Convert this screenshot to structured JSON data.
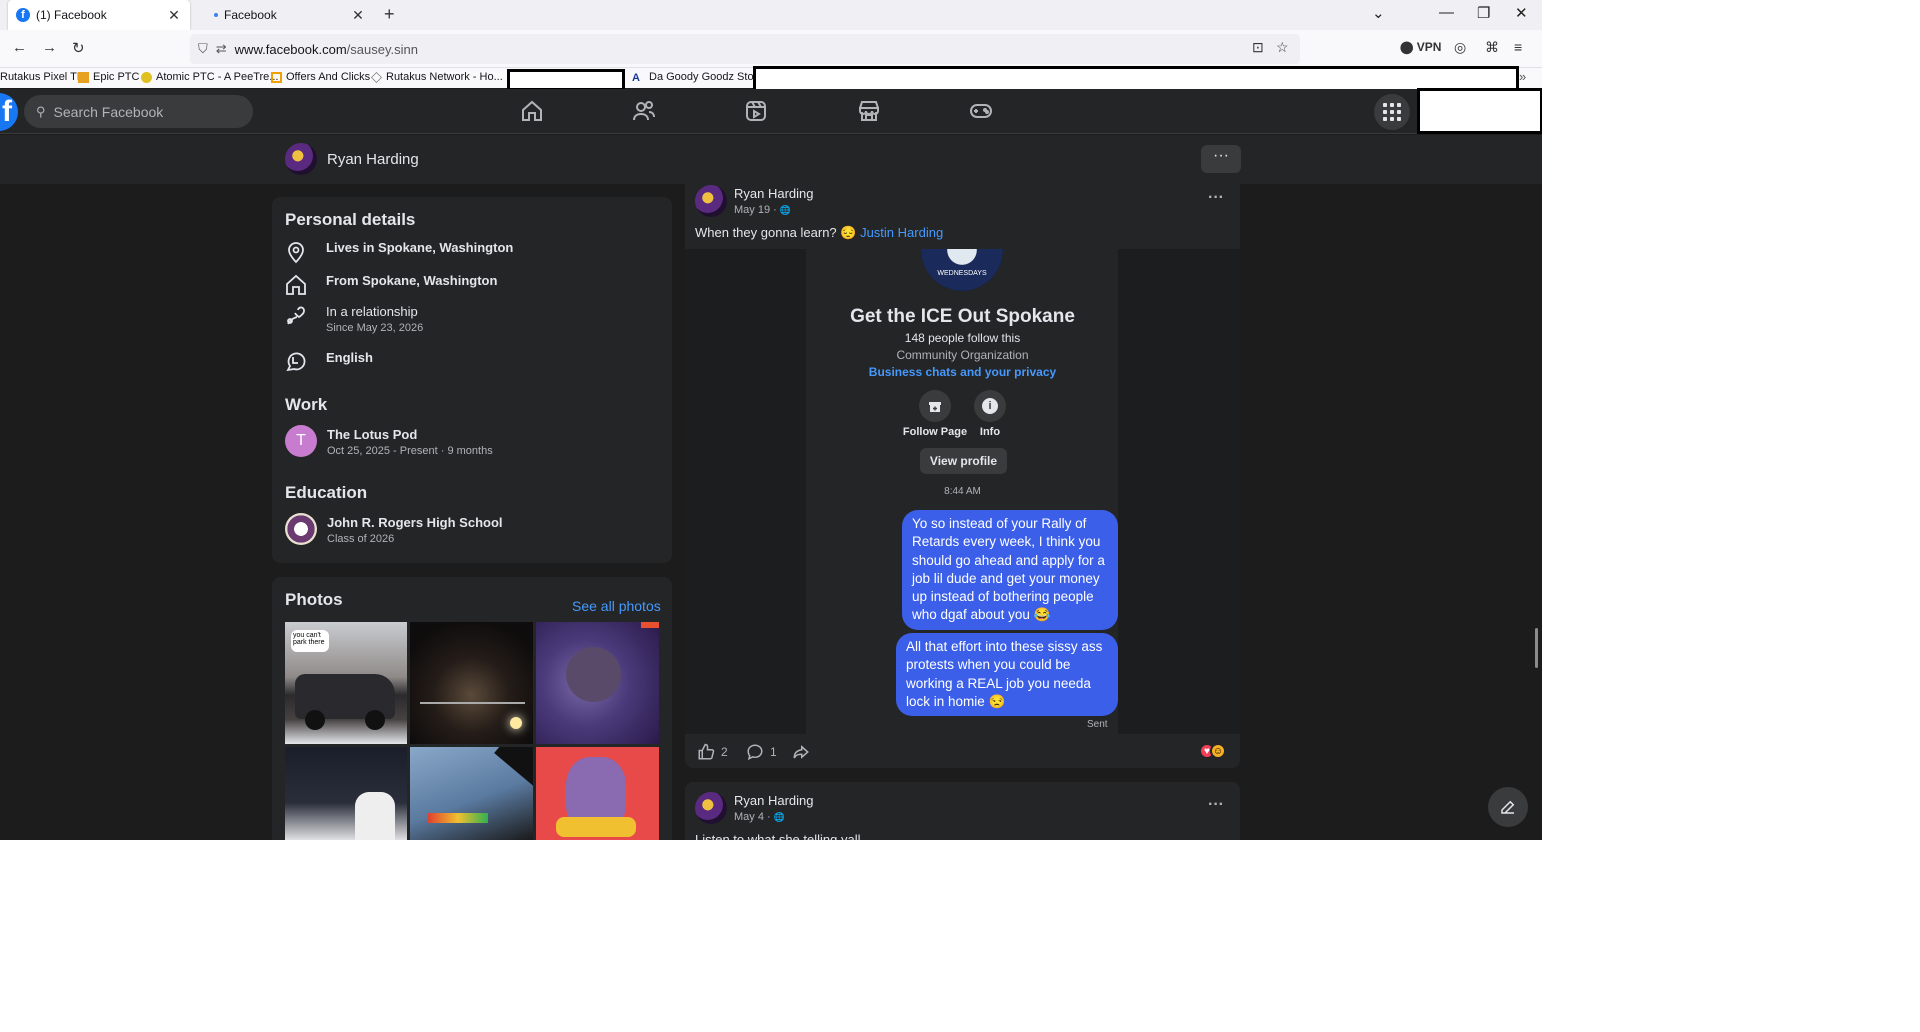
{
  "browser": {
    "tabs": [
      {
        "title": "(1) Facebook",
        "close": "✕"
      },
      {
        "title": "Facebook",
        "close": "✕"
      }
    ],
    "new_tab": "+",
    "window_controls": [
      "⌄",
      "—",
      "❐",
      "✕"
    ],
    "nav": {
      "back": "←",
      "forward": "→",
      "reload": "↻"
    },
    "url_prefix": "www.facebook.com",
    "url_path": "/sausey.sinn",
    "vpn_label": "VPN",
    "bookmarks": [
      "Rutakus Pixel TE",
      "Epic PTC",
      "Atomic PTC - A PeeTre...",
      "Offers And Clicks",
      "Rutakus Network - Ho...",
      "Da Goody Goodz Store"
    ],
    "bookmarks_overflow": "»"
  },
  "fb": {
    "logo": "f",
    "search_placeholder": "Search Facebook",
    "profile_name": "Ryan Harding",
    "more": "···"
  },
  "personal": {
    "heading": "Personal details",
    "lives": "Lives in Spokane, Washington",
    "from": "From Spokane, Washington",
    "relationship": "In a relationship",
    "relationship_since": "Since May 23, 2026",
    "language": "English"
  },
  "work": {
    "heading": "Work",
    "avatar_letter": "T",
    "place": "The Lotus Pod",
    "dates": "Oct 25, 2025 - Present · 9 months"
  },
  "education": {
    "heading": "Education",
    "school": "John R. Rogers High School",
    "class": "Class of 2026"
  },
  "photos": {
    "heading": "Photos",
    "see_all": "See all photos",
    "sticker_text": "you can't park there"
  },
  "post1": {
    "author": "Ryan Harding",
    "date": "May 19 · ",
    "privacy_icon": "🌐",
    "text": "When they gonna learn? 😔 ",
    "tag": "Justin Harding",
    "dots": "···",
    "shot": {
      "logo_text": "WEDNESDAYS",
      "page_title": "Get the ICE Out Spokane",
      "followers": "148 people follow this",
      "category": "Community Organization",
      "privacy_link": "Business chats and your privacy",
      "follow_label": "Follow Page",
      "info_label": "Info",
      "info_icon": "i",
      "view_profile": "View profile",
      "time": "8:44 AM",
      "msg1": "Yo so instead of your Rally of Retards every week, I think you should go ahead and apply for a job lil dude and get your money up instead of bothering people who dgaf about you 😂",
      "msg2": "All that effort into these sissy ass protests when you could be working a REAL job you needa lock in homie 😒",
      "sent": "Sent"
    },
    "likes": "2",
    "comments": "1"
  },
  "post2": {
    "author": "Ryan Harding",
    "date": "May 4 · ",
    "privacy_icon": "🌐",
    "text": "Listen to what she telling yall",
    "dots": "···"
  },
  "colors": {
    "bg": "#1c1c1d",
    "card": "#242526",
    "accent": "#4599ff",
    "bubble": "#3b5fe8",
    "fb_blue": "#1877f2"
  }
}
